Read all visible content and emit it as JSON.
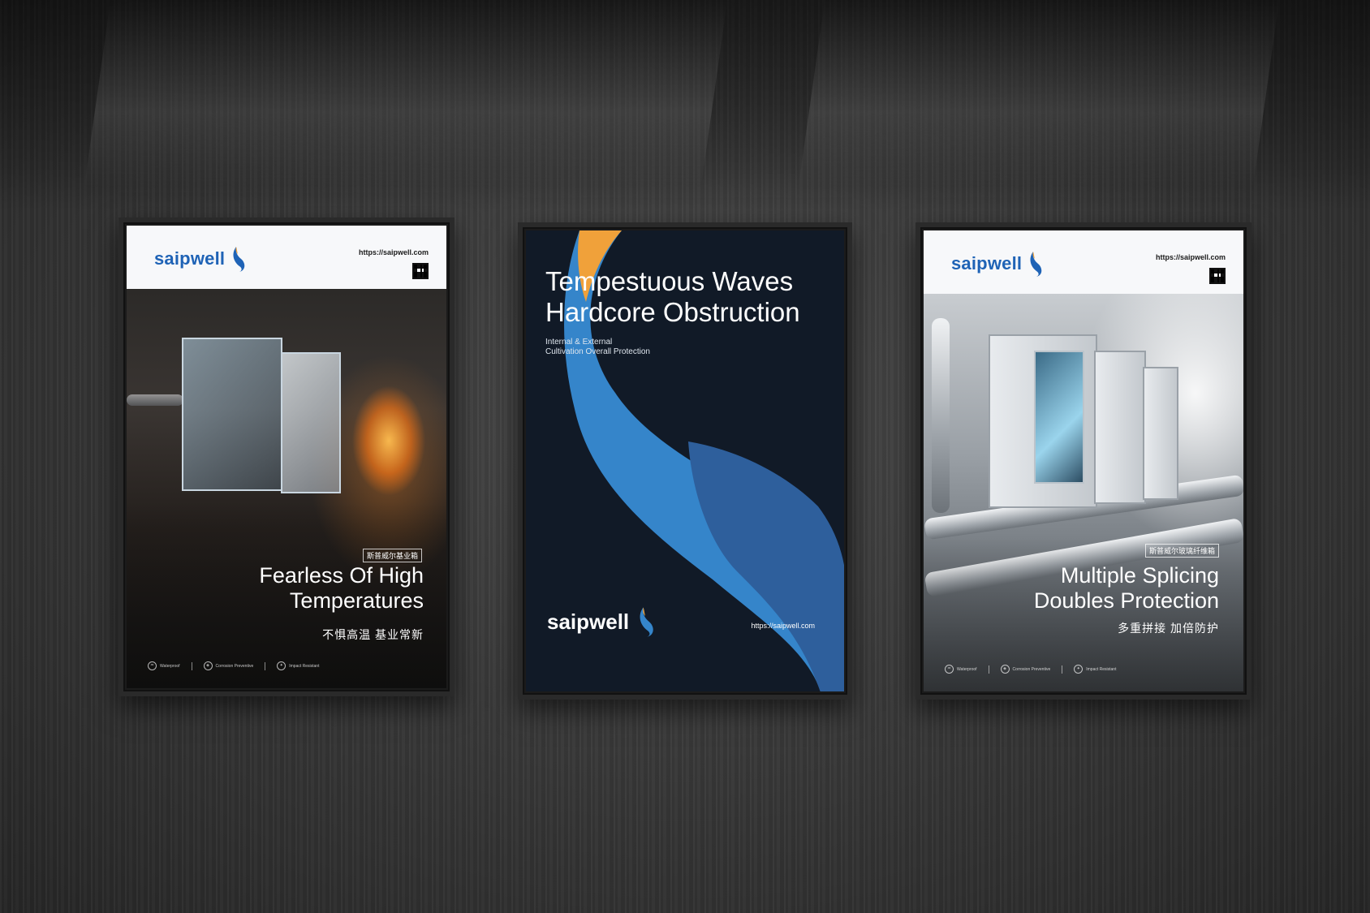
{
  "posters": [
    {
      "brand": "saipwell",
      "url": "https://saipwell.com",
      "tag": "斯普威尔基业箱",
      "headline_line1": "Fearless Of High",
      "headline_line2": "Temperatures",
      "subline": "不惧高温  基业常新",
      "features": [
        {
          "icon": "water-drop-icon",
          "label": "Waterproof"
        },
        {
          "icon": "shield-icon",
          "label": "Corrosion Preventive"
        },
        {
          "icon": "impact-icon",
          "label": "Impact Resistant"
        }
      ]
    },
    {
      "brand": "saipwell",
      "url": "https://saipwell.com",
      "title_line1": "Tempestuous Waves",
      "title_line2": "Hardcore Obstruction",
      "sub_line1": "Internal & External",
      "sub_line2": "Cultivation Overall Protection"
    },
    {
      "brand": "saipwell",
      "url": "https://saipwell.com",
      "tag": "斯普威尔玻璃纤维箱",
      "headline_line1": "Multiple Splicing",
      "headline_line2": "Doubles Protection",
      "subline": "多重拼接  加倍防护",
      "features": [
        {
          "icon": "water-drop-icon",
          "label": "Waterproof"
        },
        {
          "icon": "shield-icon",
          "label": "Corrosion Preventive"
        },
        {
          "icon": "impact-icon",
          "label": "Impact Resistant"
        }
      ]
    }
  ],
  "colors": {
    "brand_blue": "#1f63b6",
    "wave_light": "#3585ca",
    "wave_dark": "#2e5f9c",
    "wave_orange": "#f0a13a",
    "navy": "#111a27"
  }
}
